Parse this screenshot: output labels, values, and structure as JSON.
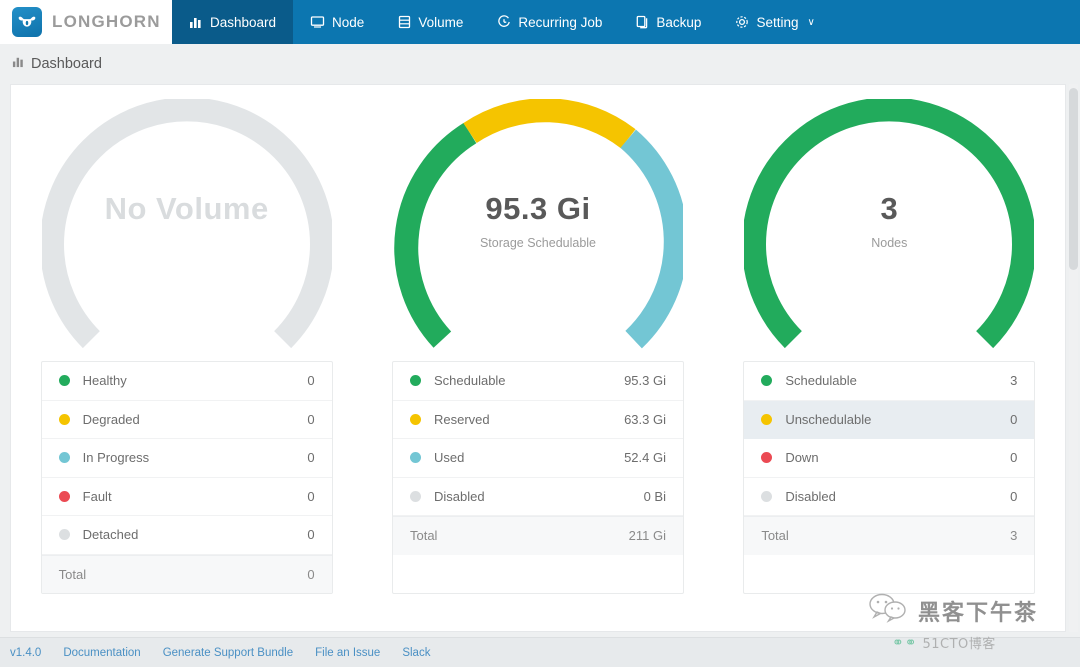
{
  "brand": {
    "name": "LONGHORN",
    "logo_icon": "longhorn-bull-icon"
  },
  "nav": {
    "items": [
      {
        "label": "Dashboard",
        "icon": "bar-chart-icon",
        "active": true
      },
      {
        "label": "Node",
        "icon": "node-screen-icon",
        "active": false
      },
      {
        "label": "Volume",
        "icon": "volume-list-icon",
        "active": false
      },
      {
        "label": "Recurring Job",
        "icon": "clock-icon",
        "active": false
      },
      {
        "label": "Backup",
        "icon": "backup-copy-icon",
        "active": false
      },
      {
        "label": "Setting",
        "icon": "gear-icon",
        "active": false,
        "chevron": "∨"
      }
    ]
  },
  "breadcrumb": {
    "icon": "bar-chart-icon",
    "label": "Dashboard"
  },
  "colors": {
    "nav_bg": "#0c76b0",
    "nav_active": "#0a5b8a",
    "green": "#22ab5c",
    "yellow": "#f5c400",
    "cyan": "#73c6d4",
    "red": "#eb4a53",
    "grey": "#e2e5e7",
    "link": "#4a90c4"
  },
  "chart_data": [
    {
      "type": "pie",
      "title": "No Volume",
      "center_value": "No Volume",
      "center_label": "",
      "empty": true,
      "categories": [
        "Healthy",
        "Degraded",
        "In Progress",
        "Fault",
        "Detached"
      ],
      "values": [
        0,
        0,
        0,
        0,
        0
      ],
      "colors": [
        "#22ab5c",
        "#f5c400",
        "#73c6d4",
        "#eb4a53",
        "#dcdfe1"
      ],
      "total": 0,
      "legend_position": "below"
    },
    {
      "type": "pie",
      "title": "Storage Schedulable",
      "center_value": "95.3 Gi",
      "center_label": "Storage Schedulable",
      "empty": false,
      "categories": [
        "Schedulable",
        "Reserved",
        "Used",
        "Disabled"
      ],
      "values": [
        95.3,
        63.3,
        52.4,
        0
      ],
      "value_labels": [
        "95.3 Gi",
        "63.3 Gi",
        "52.4 Gi",
        "0 Bi"
      ],
      "colors": [
        "#22ab5c",
        "#f5c400",
        "#73c6d4",
        "#dcdfe1"
      ],
      "total": 211,
      "total_label": "211 Gi",
      "unit": "Gi",
      "legend_position": "below"
    },
    {
      "type": "pie",
      "title": "Nodes",
      "center_value": "3",
      "center_label": "Nodes",
      "empty": false,
      "categories": [
        "Schedulable",
        "Unschedulable",
        "Down",
        "Disabled"
      ],
      "values": [
        3,
        0,
        0,
        0
      ],
      "colors": [
        "#22ab5c",
        "#f5c400",
        "#eb4a53",
        "#dcdfe1"
      ],
      "total": 3,
      "legend_position": "below"
    }
  ],
  "gauges": [
    {
      "value": "No Volume",
      "label": "",
      "muted": true
    },
    {
      "value": "95.3 Gi",
      "label": "Storage Schedulable",
      "muted": false
    },
    {
      "value": "3",
      "label": "Nodes",
      "muted": false
    }
  ],
  "tables": [
    {
      "rows": [
        {
          "label": "Healthy",
          "value": "0",
          "color": "#22ab5c",
          "hover": false
        },
        {
          "label": "Degraded",
          "value": "0",
          "color": "#f5c400",
          "hover": false
        },
        {
          "label": "In Progress",
          "value": "0",
          "color": "#73c6d4",
          "hover": false
        },
        {
          "label": "Fault",
          "value": "0",
          "color": "#eb4a53",
          "hover": false
        },
        {
          "label": "Detached",
          "value": "0",
          "color": "#dcdfe1",
          "hover": false
        }
      ],
      "total": {
        "label": "Total",
        "value": "0"
      }
    },
    {
      "rows": [
        {
          "label": "Schedulable",
          "value": "95.3 Gi",
          "color": "#22ab5c",
          "hover": false
        },
        {
          "label": "Reserved",
          "value": "63.3 Gi",
          "color": "#f5c400",
          "hover": false
        },
        {
          "label": "Used",
          "value": "52.4 Gi",
          "color": "#73c6d4",
          "hover": false
        },
        {
          "label": "Disabled",
          "value": "0 Bi",
          "color": "#dcdfe1",
          "hover": false
        }
      ],
      "total": {
        "label": "Total",
        "value": "211 Gi"
      }
    },
    {
      "rows": [
        {
          "label": "Schedulable",
          "value": "3",
          "color": "#22ab5c",
          "hover": false
        },
        {
          "label": "Unschedulable",
          "value": "0",
          "color": "#f5c400",
          "hover": true
        },
        {
          "label": "Down",
          "value": "0",
          "color": "#eb4a53",
          "hover": false
        },
        {
          "label": "Disabled",
          "value": "0",
          "color": "#dcdfe1",
          "hover": false
        }
      ],
      "total": {
        "label": "Total",
        "value": "3"
      }
    }
  ],
  "footer": {
    "links": [
      {
        "label": "v1.4.0"
      },
      {
        "label": "Documentation"
      },
      {
        "label": "Generate Support Bundle"
      },
      {
        "label": "File an Issue"
      },
      {
        "label": "Slack"
      }
    ]
  },
  "watermark": {
    "title": "黑客下午茶",
    "sub": "51CTO博客",
    "icon": "wechat-icon"
  }
}
